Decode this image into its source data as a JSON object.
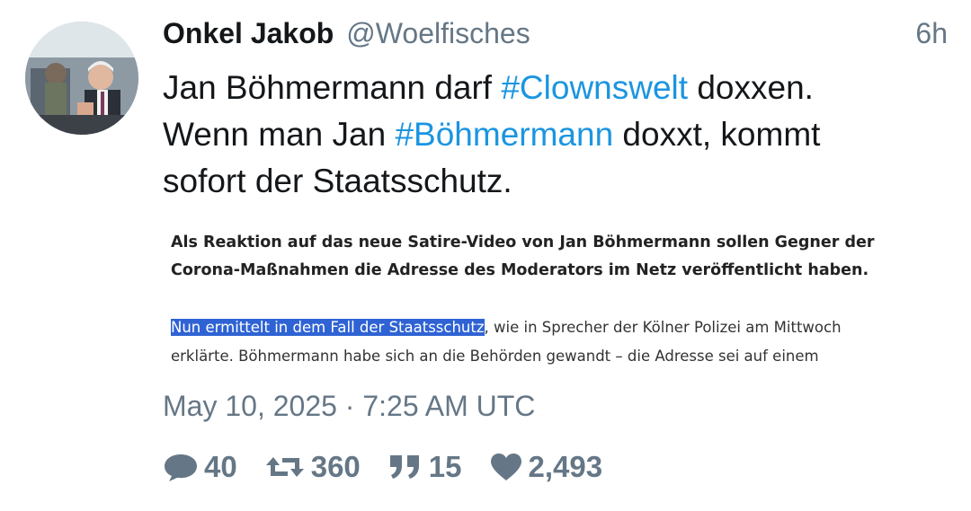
{
  "tweet": {
    "display_name": "Onkel Jakob",
    "handle": "@Woelfisches",
    "time_ago": "6h",
    "text_segments": {
      "l1a": "Jan Böhmermann darf ",
      "l1_hashtag": "#Clownswelt",
      "l1b": " doxxen.",
      "l2a": "Wenn man Jan ",
      "l2_hashtag": "#Böhmermann",
      "l2b": " doxxt, kommt",
      "l3": "sofort der Staatsschutz."
    },
    "hashtag_color": "#1b95e0",
    "embedded_image": {
      "lead_line_1": "Als Reaktion auf das neue Satire-Video von Jan Böhmermann sollen Gegner der",
      "lead_line_2": "Corona-Maßnahmen die Adresse des Moderators im Netz veröffentlicht haben.",
      "body_highlight": "Nun ermittelt in dem Fall der Staatsschutz",
      "body_line_1_rest": ", wie in Sprecher der Kölner Polizei am Mittwoch",
      "body_line_2": "erklärte. Böhmermann habe sich an die Behörden gewandt – die Adresse sei auf einem",
      "highlight_color": "#2f63d4"
    },
    "timestamp": "May 10, 2025 · 7:25 AM UTC",
    "stats": {
      "replies": "40",
      "retweets": "360",
      "quotes": "15",
      "likes": "2,493"
    },
    "icons": {
      "replies": "speech-bubble-icon",
      "retweets": "retweet-icon",
      "quotes": "quote-icon",
      "likes": "heart-icon"
    }
  }
}
